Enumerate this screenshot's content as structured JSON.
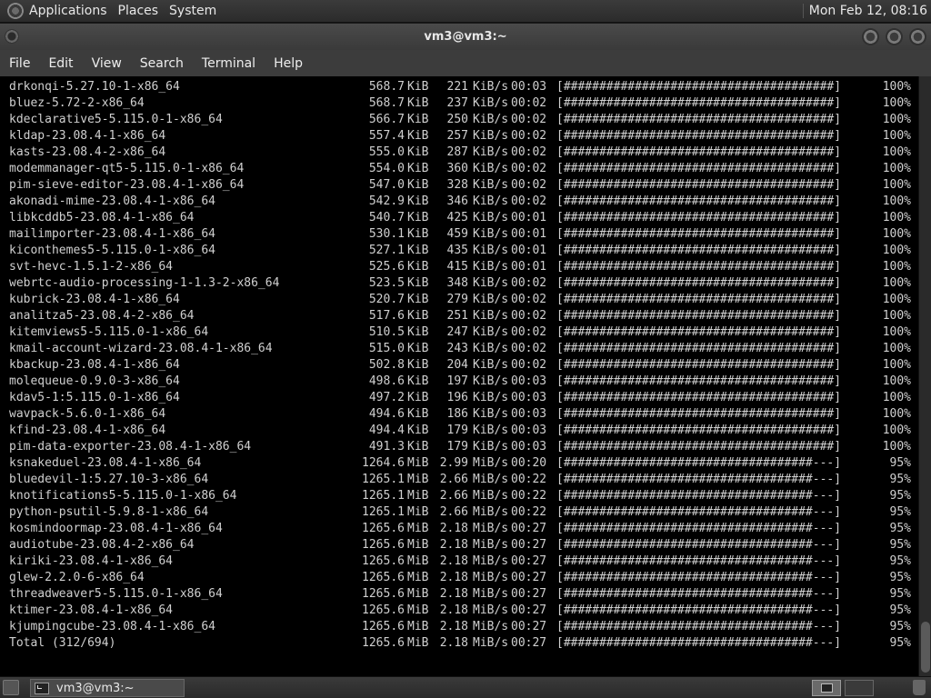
{
  "top_panel": {
    "menus": [
      "Applications",
      "Places",
      "System"
    ],
    "clock": "Mon Feb 12, 08:16"
  },
  "window": {
    "title": "vm3@vm3:~",
    "menus": [
      "File",
      "Edit",
      "View",
      "Search",
      "Terminal",
      "Help"
    ]
  },
  "terminal": {
    "rows": [
      {
        "name": "drkonqi-5.27.10-1-x86_64",
        "size": "568.7",
        "unit": "KiB",
        "rate": "221",
        "rate_unit": "KiB/s",
        "time": "00:03",
        "bar": "[######################################]",
        "pct": "100%"
      },
      {
        "name": "bluez-5.72-2-x86_64",
        "size": "568.7",
        "unit": "KiB",
        "rate": "237",
        "rate_unit": "KiB/s",
        "time": "00:02",
        "bar": "[######################################]",
        "pct": "100%"
      },
      {
        "name": "kdeclarative5-5.115.0-1-x86_64",
        "size": "566.7",
        "unit": "KiB",
        "rate": "250",
        "rate_unit": "KiB/s",
        "time": "00:02",
        "bar": "[######################################]",
        "pct": "100%"
      },
      {
        "name": "kldap-23.08.4-1-x86_64",
        "size": "557.4",
        "unit": "KiB",
        "rate": "257",
        "rate_unit": "KiB/s",
        "time": "00:02",
        "bar": "[######################################]",
        "pct": "100%"
      },
      {
        "name": "kasts-23.08.4-2-x86_64",
        "size": "555.0",
        "unit": "KiB",
        "rate": "287",
        "rate_unit": "KiB/s",
        "time": "00:02",
        "bar": "[######################################]",
        "pct": "100%"
      },
      {
        "name": "modemmanager-qt5-5.115.0-1-x86_64",
        "size": "554.0",
        "unit": "KiB",
        "rate": "360",
        "rate_unit": "KiB/s",
        "time": "00:02",
        "bar": "[######################################]",
        "pct": "100%"
      },
      {
        "name": "pim-sieve-editor-23.08.4-1-x86_64",
        "size": "547.0",
        "unit": "KiB",
        "rate": "328",
        "rate_unit": "KiB/s",
        "time": "00:02",
        "bar": "[######################################]",
        "pct": "100%"
      },
      {
        "name": "akonadi-mime-23.08.4-1-x86_64",
        "size": "542.9",
        "unit": "KiB",
        "rate": "346",
        "rate_unit": "KiB/s",
        "time": "00:02",
        "bar": "[######################################]",
        "pct": "100%"
      },
      {
        "name": "libkcddb5-23.08.4-1-x86_64",
        "size": "540.7",
        "unit": "KiB",
        "rate": "425",
        "rate_unit": "KiB/s",
        "time": "00:01",
        "bar": "[######################################]",
        "pct": "100%"
      },
      {
        "name": "mailimporter-23.08.4-1-x86_64",
        "size": "530.1",
        "unit": "KiB",
        "rate": "459",
        "rate_unit": "KiB/s",
        "time": "00:01",
        "bar": "[######################################]",
        "pct": "100%"
      },
      {
        "name": "kiconthemes5-5.115.0-1-x86_64",
        "size": "527.1",
        "unit": "KiB",
        "rate": "435",
        "rate_unit": "KiB/s",
        "time": "00:01",
        "bar": "[######################################]",
        "pct": "100%"
      },
      {
        "name": "svt-hevc-1.5.1-2-x86_64",
        "size": "525.6",
        "unit": "KiB",
        "rate": "415",
        "rate_unit": "KiB/s",
        "time": "00:01",
        "bar": "[######################################]",
        "pct": "100%"
      },
      {
        "name": "webrtc-audio-processing-1-1.3-2-x86_64",
        "size": "523.5",
        "unit": "KiB",
        "rate": "348",
        "rate_unit": "KiB/s",
        "time": "00:02",
        "bar": "[######################################]",
        "pct": "100%"
      },
      {
        "name": "kubrick-23.08.4-1-x86_64",
        "size": "520.7",
        "unit": "KiB",
        "rate": "279",
        "rate_unit": "KiB/s",
        "time": "00:02",
        "bar": "[######################################]",
        "pct": "100%"
      },
      {
        "name": "analitza5-23.08.4-2-x86_64",
        "size": "517.6",
        "unit": "KiB",
        "rate": "251",
        "rate_unit": "KiB/s",
        "time": "00:02",
        "bar": "[######################################]",
        "pct": "100%"
      },
      {
        "name": "kitemviews5-5.115.0-1-x86_64",
        "size": "510.5",
        "unit": "KiB",
        "rate": "247",
        "rate_unit": "KiB/s",
        "time": "00:02",
        "bar": "[######################################]",
        "pct": "100%"
      },
      {
        "name": "kmail-account-wizard-23.08.4-1-x86_64",
        "size": "515.0",
        "unit": "KiB",
        "rate": "243",
        "rate_unit": "KiB/s",
        "time": "00:02",
        "bar": "[######################################]",
        "pct": "100%"
      },
      {
        "name": "kbackup-23.08.4-1-x86_64",
        "size": "502.8",
        "unit": "KiB",
        "rate": "204",
        "rate_unit": "KiB/s",
        "time": "00:02",
        "bar": "[######################################]",
        "pct": "100%"
      },
      {
        "name": "molequeue-0.9.0-3-x86_64",
        "size": "498.6",
        "unit": "KiB",
        "rate": "197",
        "rate_unit": "KiB/s",
        "time": "00:03",
        "bar": "[######################################]",
        "pct": "100%"
      },
      {
        "name": "kdav5-1:5.115.0-1-x86_64",
        "size": "497.2",
        "unit": "KiB",
        "rate": "196",
        "rate_unit": "KiB/s",
        "time": "00:03",
        "bar": "[######################################]",
        "pct": "100%"
      },
      {
        "name": "wavpack-5.6.0-1-x86_64",
        "size": "494.6",
        "unit": "KiB",
        "rate": "186",
        "rate_unit": "KiB/s",
        "time": "00:03",
        "bar": "[######################################]",
        "pct": "100%"
      },
      {
        "name": "kfind-23.08.4-1-x86_64",
        "size": "494.4",
        "unit": "KiB",
        "rate": "179",
        "rate_unit": "KiB/s",
        "time": "00:03",
        "bar": "[######################################]",
        "pct": "100%"
      },
      {
        "name": "pim-data-exporter-23.08.4-1-x86_64",
        "size": "491.3",
        "unit": "KiB",
        "rate": "179",
        "rate_unit": "KiB/s",
        "time": "00:03",
        "bar": "[######################################]",
        "pct": "100%"
      },
      {
        "name": "ksnakeduel-23.08.4-1-x86_64",
        "size": "1264.6",
        "unit": "MiB",
        "rate": "2.99",
        "rate_unit": "MiB/s",
        "time": "00:20",
        "bar": "[###################################---]",
        "pct": "95%"
      },
      {
        "name": "bluedevil-1:5.27.10-3-x86_64",
        "size": "1265.1",
        "unit": "MiB",
        "rate": "2.66",
        "rate_unit": "MiB/s",
        "time": "00:22",
        "bar": "[###################################---]",
        "pct": "95%"
      },
      {
        "name": "knotifications5-5.115.0-1-x86_64",
        "size": "1265.1",
        "unit": "MiB",
        "rate": "2.66",
        "rate_unit": "MiB/s",
        "time": "00:22",
        "bar": "[###################################---]",
        "pct": "95%"
      },
      {
        "name": "python-psutil-5.9.8-1-x86_64",
        "size": "1265.1",
        "unit": "MiB",
        "rate": "2.66",
        "rate_unit": "MiB/s",
        "time": "00:22",
        "bar": "[###################################---]",
        "pct": "95%"
      },
      {
        "name": "kosmindoormap-23.08.4-1-x86_64",
        "size": "1265.6",
        "unit": "MiB",
        "rate": "2.18",
        "rate_unit": "MiB/s",
        "time": "00:27",
        "bar": "[###################################---]",
        "pct": "95%"
      },
      {
        "name": "audiotube-23.08.4-2-x86_64",
        "size": "1265.6",
        "unit": "MiB",
        "rate": "2.18",
        "rate_unit": "MiB/s",
        "time": "00:27",
        "bar": "[###################################---]",
        "pct": "95%"
      },
      {
        "name": "kiriki-23.08.4-1-x86_64",
        "size": "1265.6",
        "unit": "MiB",
        "rate": "2.18",
        "rate_unit": "MiB/s",
        "time": "00:27",
        "bar": "[###################################---]",
        "pct": "95%"
      },
      {
        "name": "glew-2.2.0-6-x86_64",
        "size": "1265.6",
        "unit": "MiB",
        "rate": "2.18",
        "rate_unit": "MiB/s",
        "time": "00:27",
        "bar": "[###################################---]",
        "pct": "95%"
      },
      {
        "name": "threadweaver5-5.115.0-1-x86_64",
        "size": "1265.6",
        "unit": "MiB",
        "rate": "2.18",
        "rate_unit": "MiB/s",
        "time": "00:27",
        "bar": "[###################################---]",
        "pct": "95%"
      },
      {
        "name": "ktimer-23.08.4-1-x86_64",
        "size": "1265.6",
        "unit": "MiB",
        "rate": "2.18",
        "rate_unit": "MiB/s",
        "time": "00:27",
        "bar": "[###################################---]",
        "pct": "95%"
      },
      {
        "name": "kjumpingcube-23.08.4-1-x86_64",
        "size": "1265.6",
        "unit": "MiB",
        "rate": "2.18",
        "rate_unit": "MiB/s",
        "time": "00:27",
        "bar": "[###################################---]",
        "pct": "95%"
      },
      {
        "name": "Total (312/694)",
        "size": "1265.6",
        "unit": "MiB",
        "rate": "2.18",
        "rate_unit": "MiB/s",
        "time": "00:27",
        "bar": "[###################################---]",
        "pct": "95%"
      }
    ]
  },
  "taskbar": {
    "task_label": "vm3@vm3:~"
  },
  "colors": {
    "terminal_bg": "#000000",
    "terminal_fg": "#d0d0d0",
    "panel_bg": "#2e2e2e"
  }
}
